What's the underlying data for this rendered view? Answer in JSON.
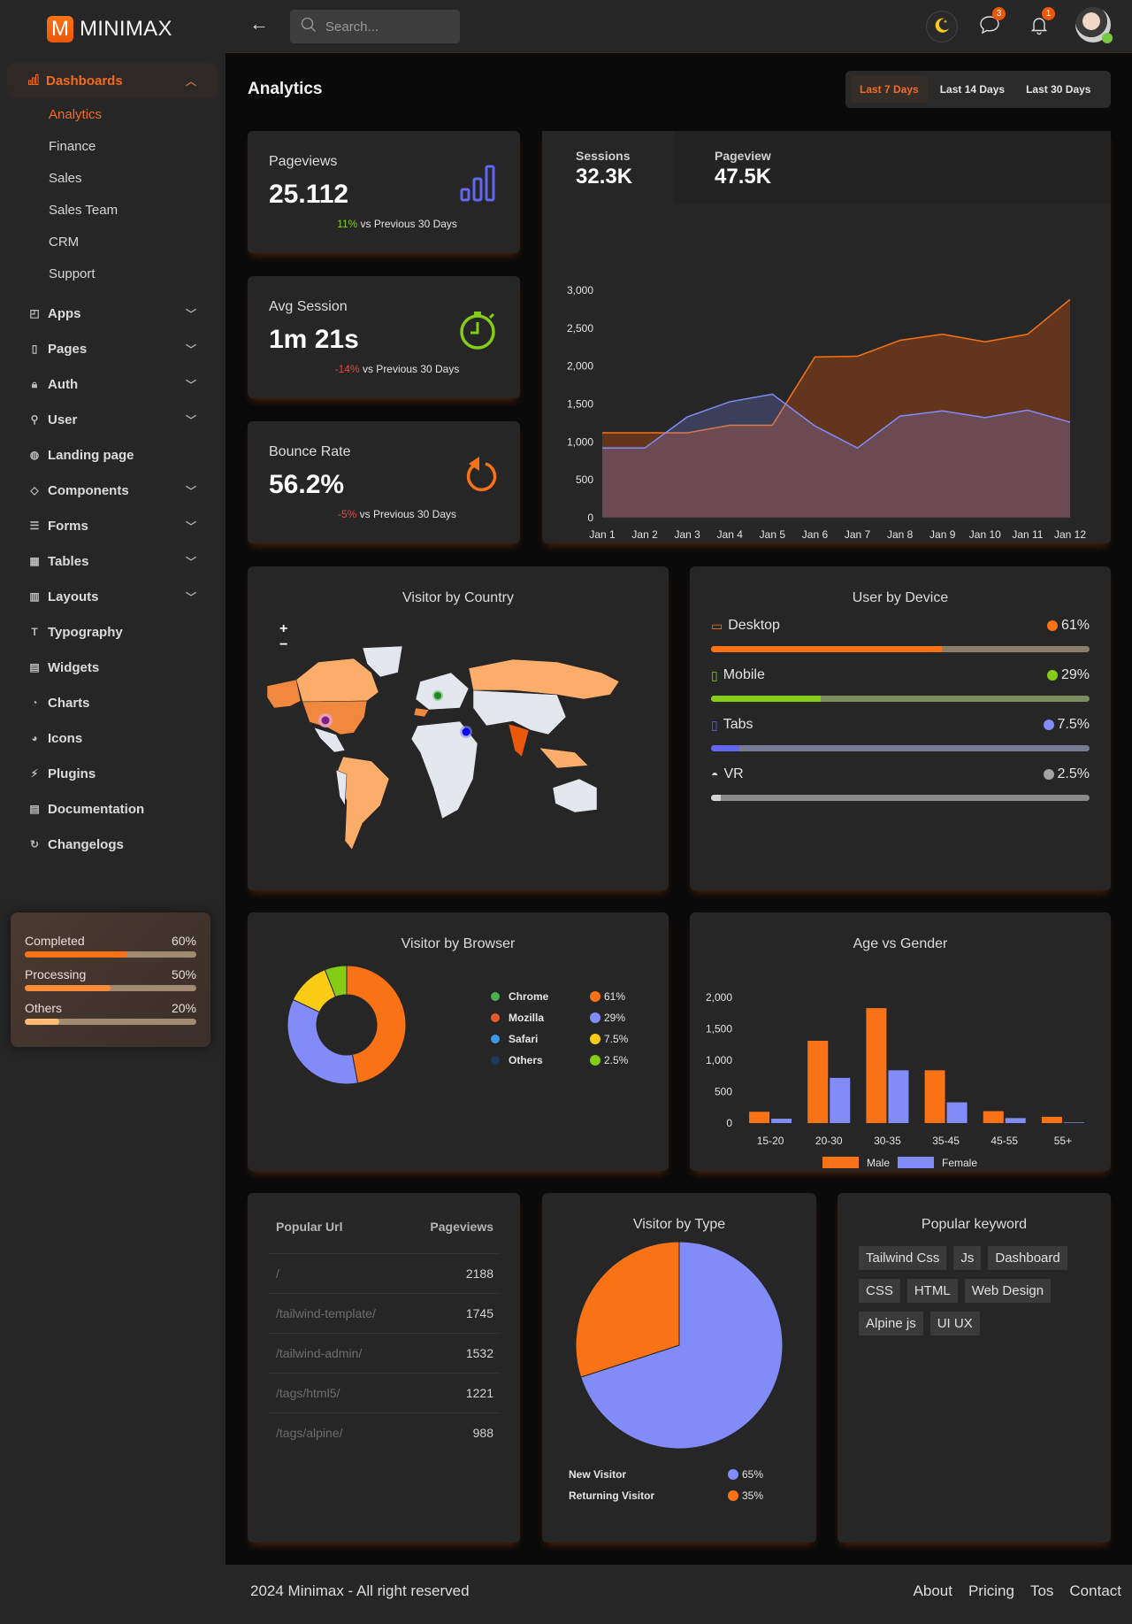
{
  "app": {
    "logo_letter": "M",
    "name": "MINIMAX"
  },
  "sidebar": {
    "group": {
      "label": "Dashboards",
      "icon": "bar-chart-icon",
      "expanded": true
    },
    "subitems": [
      {
        "label": "Analytics",
        "active": true
      },
      {
        "label": "Finance"
      },
      {
        "label": "Sales"
      },
      {
        "label": "Sales Team"
      },
      {
        "label": "CRM"
      },
      {
        "label": "Support"
      }
    ],
    "items": [
      {
        "label": "Apps",
        "icon": "apps-icon",
        "has_children": true
      },
      {
        "label": "Pages",
        "icon": "page-icon",
        "has_children": true
      },
      {
        "label": "Auth",
        "icon": "lock-icon",
        "has_children": true
      },
      {
        "label": "User",
        "icon": "user-icon",
        "has_children": true
      },
      {
        "label": "Landing page",
        "icon": "globe-icon",
        "has_children": false
      },
      {
        "label": "Components",
        "icon": "layers-icon",
        "has_children": true
      },
      {
        "label": "Forms",
        "icon": "list-icon",
        "has_children": true
      },
      {
        "label": "Tables",
        "icon": "table-icon",
        "has_children": true
      },
      {
        "label": "Layouts",
        "icon": "layout-icon",
        "has_children": true
      },
      {
        "label": "Typography",
        "icon": "typography-icon",
        "has_children": false
      },
      {
        "label": "Widgets",
        "icon": "widgets-icon",
        "has_children": false
      },
      {
        "label": "Charts",
        "icon": "pie-chart-icon",
        "has_children": false
      },
      {
        "label": "Icons",
        "icon": "shapes-icon",
        "has_children": false
      },
      {
        "label": "Plugins",
        "icon": "plug-icon",
        "has_children": false
      },
      {
        "label": "Documentation",
        "icon": "document-icon",
        "has_children": false
      },
      {
        "label": "Changelogs",
        "icon": "refresh-icon",
        "has_children": false
      }
    ],
    "progress": [
      {
        "label": "Completed",
        "value_text": "60%",
        "value": 60,
        "color": "#f97316"
      },
      {
        "label": "Processing",
        "value_text": "50%",
        "value": 50,
        "color": "#fb8c3a"
      },
      {
        "label": "Others",
        "value_text": "20%",
        "value": 20,
        "color": "#fdba74"
      }
    ]
  },
  "topbar": {
    "search_placeholder": "Search...",
    "messages_badge": "3",
    "notifications_badge": "1"
  },
  "page": {
    "title": "Analytics",
    "ranges": [
      {
        "label": "Last 7 Days",
        "active": true
      },
      {
        "label": "Last 14 Days"
      },
      {
        "label": "Last 30 Days"
      }
    ]
  },
  "stats": [
    {
      "label": "Pageviews",
      "value": "25.112",
      "delta": "11%",
      "delta_color": "#84cc16",
      "suffix": " vs Previous 30 Days",
      "icon": "bar-signal-icon"
    },
    {
      "label": "Avg Session",
      "value": "1m 21s",
      "delta": "-14%",
      "delta_color": "#ef4444",
      "suffix": " vs Previous 30 Days",
      "icon": "stopwatch-icon"
    },
    {
      "label": "Bounce Rate",
      "value": "56.2%",
      "delta": "-5%",
      "delta_color": "#ef4444",
      "suffix": " vs Previous 30 Days",
      "icon": "rotate-icon"
    }
  ],
  "traffic": {
    "kpis": [
      {
        "label": "Sessions",
        "value": "32.3K"
      },
      {
        "label": "Pageview",
        "value": "47.5K"
      }
    ]
  },
  "map": {
    "title": "Visitor by Country",
    "zoom_in": "+",
    "zoom_out": "−"
  },
  "devices": {
    "title": "User by Device",
    "items": [
      {
        "label": "Desktop",
        "value_text": "61%",
        "value": 61,
        "color": "#f97316",
        "track": "#8d7d6b",
        "icon": "laptop-icon"
      },
      {
        "label": "Mobile",
        "value_text": "29%",
        "value": 29,
        "color": "#84cc16",
        "track": "#7e8c62",
        "icon": "mobile-icon"
      },
      {
        "label": "Tabs",
        "value_text": "7.5%",
        "value": 7.5,
        "color": "#6366f1",
        "track": "#777c94",
        "icon": "tablet-icon"
      },
      {
        "label": "VR",
        "value_text": "2.5%",
        "value": 2.5,
        "color": "#d4d4d4",
        "track": "#8a8a8a",
        "icon": "vr-headset-icon"
      }
    ]
  },
  "chart_data": [
    {
      "type": "area",
      "title": "",
      "x": [
        "Jan 1",
        "Jan 2",
        "Jan 3",
        "Jan 4",
        "Jan 5",
        "Jan 6",
        "Jan 7",
        "Jan 8",
        "Jan 9",
        "Jan 10",
        "Jan 11",
        "Jan 12"
      ],
      "series": [
        {
          "name": "Sessions",
          "color": "#f97316",
          "values": [
            1120,
            1120,
            1120,
            1220,
            1220,
            2120,
            2130,
            2340,
            2420,
            2320,
            2420,
            2880
          ]
        },
        {
          "name": "Pageview",
          "color": "#818cf8",
          "values": [
            920,
            920,
            1330,
            1530,
            1630,
            1210,
            920,
            1340,
            1410,
            1320,
            1420,
            1260
          ]
        }
      ],
      "yticks": [
        0,
        500,
        1000,
        1500,
        2000,
        2500,
        3000
      ],
      "ylim": [
        0,
        3000
      ],
      "grid": false
    },
    {
      "type": "pie",
      "title": "Visitor by Browser",
      "donut": true,
      "labels": [
        "Chrome",
        "Mozilla",
        "Safari",
        "Others"
      ],
      "legend_values": [
        "61%",
        "29%",
        "7.5%",
        "2.5%"
      ],
      "values": [
        61,
        29,
        7.5,
        2.5
      ],
      "colors": [
        "#f97316",
        "#818cf8",
        "#facc15",
        "#84cc16"
      ],
      "slice_shares_drawn": [
        47,
        35,
        12,
        6
      ]
    },
    {
      "type": "bar",
      "title": "Age vs Gender",
      "categories": [
        "15-20",
        "20-30",
        "30-35",
        "35-45",
        "45-55",
        "55+"
      ],
      "series": [
        {
          "name": "Male",
          "color": "#f97316",
          "values": [
            180,
            1310,
            1830,
            840,
            190,
            100
          ]
        },
        {
          "name": "Female",
          "color": "#818cf8",
          "values": [
            70,
            720,
            840,
            330,
            80,
            10
          ]
        }
      ],
      "yticks": [
        0,
        500,
        1000,
        1500,
        2000
      ],
      "ylim": [
        0,
        2000
      ],
      "legend": "bottom"
    },
    {
      "type": "pie",
      "title": "Visitor by Type",
      "labels": [
        "New Visitor",
        "Returning Visitor"
      ],
      "legend_values": [
        "65%",
        "35%"
      ],
      "values": [
        65,
        35
      ],
      "colors": [
        "#818cf8",
        "#f97316"
      ],
      "slice_shares_drawn": [
        70,
        30
      ]
    }
  ],
  "popular_urls": {
    "headers": [
      "Popular Url",
      "Pageviews"
    ],
    "rows": [
      {
        "url": "/",
        "pageviews": "2188"
      },
      {
        "url": "/tailwind-template/",
        "pageviews": "1745"
      },
      {
        "url": "/tailwind-admin/",
        "pageviews": "1532"
      },
      {
        "url": "/tags/html5/",
        "pageviews": "1221"
      },
      {
        "url": "/tags/alpine/",
        "pageviews": "988"
      }
    ]
  },
  "keywords": {
    "title": "Popular keyword",
    "items": [
      "Tailwind Css",
      "Js",
      "Dashboard",
      "CSS",
      "HTML",
      "Web Design",
      "Alpine js",
      "UI UX"
    ]
  },
  "footer": {
    "copyright": "2024 Minimax - All right reserved",
    "links": [
      "About",
      "Pricing",
      "Tos",
      "Contact"
    ]
  }
}
